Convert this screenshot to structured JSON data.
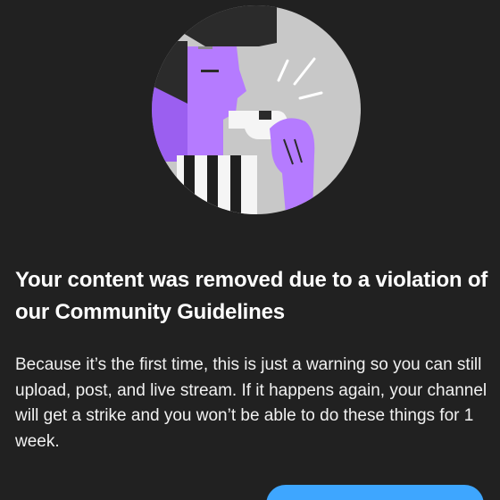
{
  "dialog": {
    "illustration_icon": "referee-whistle-illustration",
    "title": "Your content was removed due to a violation of our Community Guidelines",
    "body": "Because it’s the first time, this is just a warning so you can still upload, post, and live stream. If it happens again, your channel will get a strike and you won’t be able to do these things for 1 week.",
    "button_label": ""
  },
  "colors": {
    "background": "#212121",
    "accent": "#3ea6ff",
    "illustration_purple": "#b57bff",
    "illustration_gray": "#c4c4c4"
  }
}
